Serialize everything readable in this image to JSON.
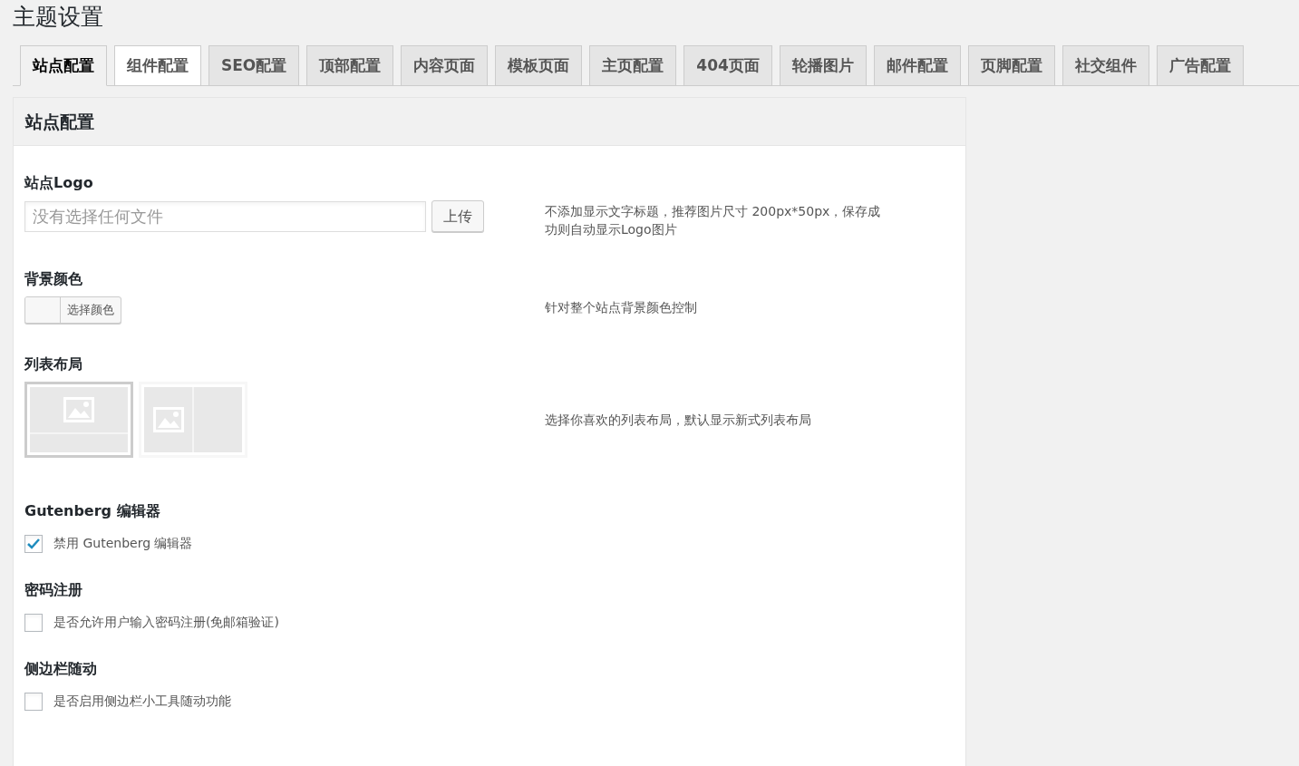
{
  "page_title": "主题设置",
  "tabs": [
    {
      "label": "站点配置",
      "selected": true,
      "hovered": false
    },
    {
      "label": "组件配置",
      "selected": false,
      "hovered": true
    },
    {
      "label": "SEO配置",
      "selected": false,
      "hovered": false
    },
    {
      "label": "顶部配置",
      "selected": false,
      "hovered": false
    },
    {
      "label": "内容页面",
      "selected": false,
      "hovered": false
    },
    {
      "label": "模板页面",
      "selected": false,
      "hovered": false
    },
    {
      "label": "主页配置",
      "selected": false,
      "hovered": false
    },
    {
      "label": "404页面",
      "selected": false,
      "hovered": false
    },
    {
      "label": "轮播图片",
      "selected": false,
      "hovered": false
    },
    {
      "label": "邮件配置",
      "selected": false,
      "hovered": false
    },
    {
      "label": "页脚配置",
      "selected": false,
      "hovered": false
    },
    {
      "label": "社交组件",
      "selected": false,
      "hovered": false
    },
    {
      "label": "广告配置",
      "selected": false,
      "hovered": false
    }
  ],
  "panel": {
    "title": "站点配置",
    "settings": [
      {
        "kind": "upload",
        "label": "站点Logo",
        "placeholder": "没有选择任何文件",
        "button": "上传",
        "description": "不添加显示文字标题，推荐图片尺寸 200px*50px，保存成功则自动显示Logo图片"
      },
      {
        "kind": "color",
        "label": "背景颜色",
        "button": "选择颜色",
        "description": "针对整个站点背景颜色控制"
      },
      {
        "kind": "layout",
        "label": "列表布局",
        "options": [
          {
            "selected": true
          },
          {
            "selected": false
          }
        ],
        "description": "选择你喜欢的列表布局，默认显示新式列表布局"
      },
      {
        "kind": "checkbox",
        "label": "Gutenberg 编辑器",
        "option": "禁用 Gutenberg 编辑器",
        "checked": true
      },
      {
        "kind": "checkbox",
        "label": "密码注册",
        "option": "是否允许用户输入密码注册(免邮箱验证)",
        "checked": false
      },
      {
        "kind": "checkbox",
        "label": "侧边栏随动",
        "option": "是否启用侧边栏小工具随动功能",
        "checked": false
      }
    ]
  }
}
